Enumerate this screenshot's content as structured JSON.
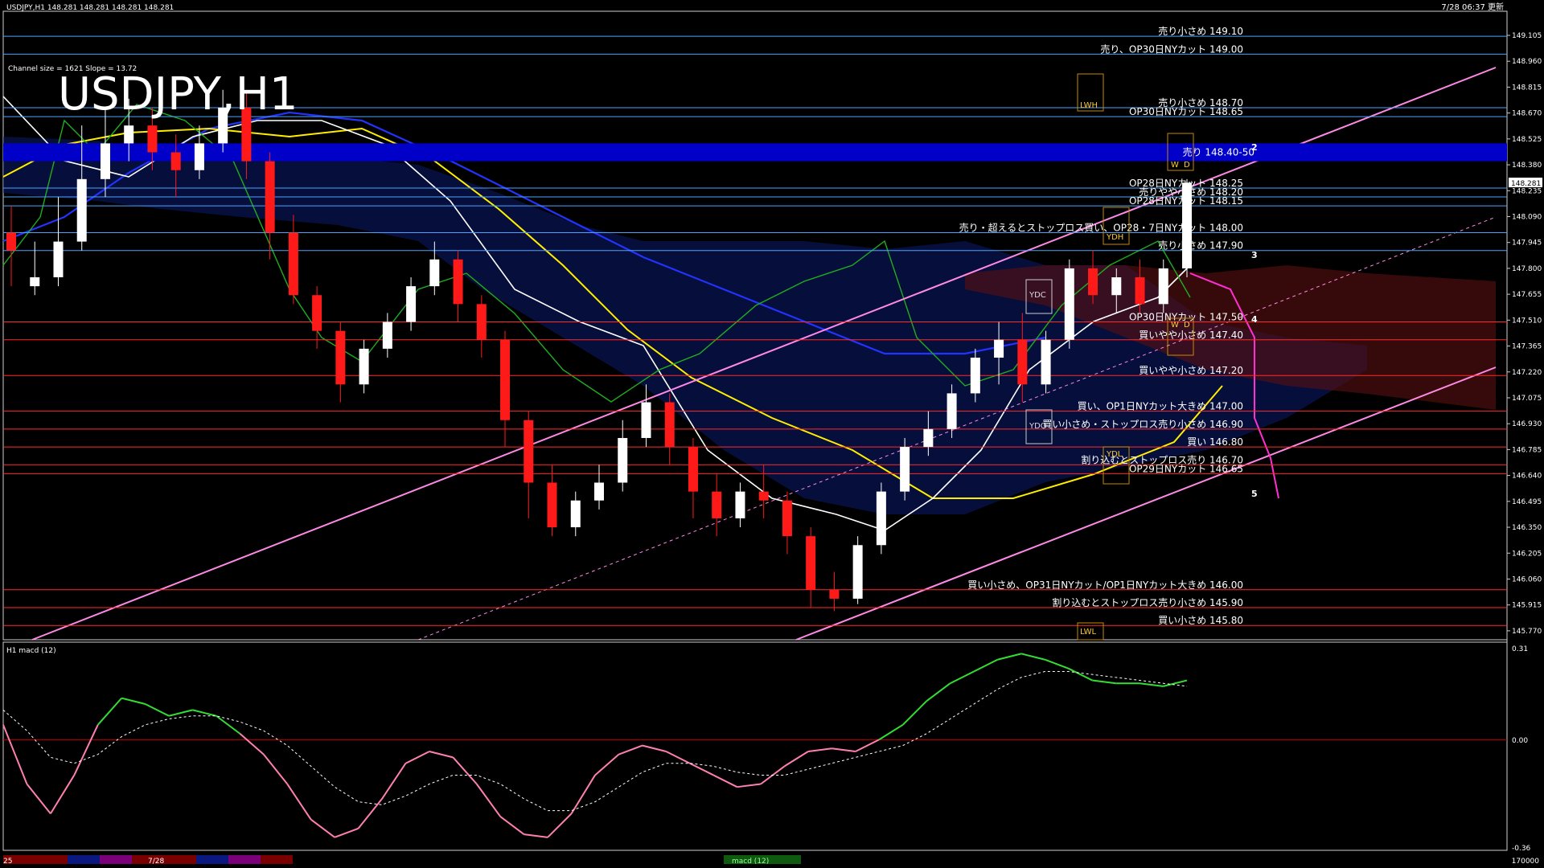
{
  "header": {
    "symbol_info": "USDJPY,H1  148.281 148.281 148.281 148.281",
    "timestamp": "7/28 06:37 更新"
  },
  "overlay": {
    "big_title": "USDJPY,H1",
    "channel_info": "Channel size = 1621 Slope = 13.72"
  },
  "chart_data": [
    {
      "type": "candlestick",
      "title": "USDJPY,H1",
      "ylim": [
        145.72,
        149.24
      ],
      "current_price": 148.281,
      "price_ticks": [
        149.105,
        148.96,
        148.815,
        148.67,
        148.525,
        148.38,
        148.235,
        148.09,
        147.945,
        147.8,
        147.655,
        147.51,
        147.365,
        147.22,
        147.075,
        146.93,
        146.785,
        146.64,
        146.495,
        146.35,
        146.205,
        146.06,
        145.915,
        145.77
      ],
      "resistance_zone": {
        "label": "売り 148.40-50",
        "low": 148.4,
        "high": 148.5
      },
      "levels": [
        {
          "price": 149.1,
          "label": "売り小さめ 149.10",
          "color": "#4aa3ff"
        },
        {
          "price": 149.0,
          "label": "売り、OP30日NYカット 149.00",
          "color": "#4aa3ff"
        },
        {
          "price": 148.7,
          "label": "売り小さめ 148.70",
          "color": "#4aa3ff"
        },
        {
          "price": 148.65,
          "label": "OP30日NYカット 148.65",
          "color": "#4aa3ff"
        },
        {
          "price": 148.25,
          "label": "OP28日NYカット 148.25",
          "color": "#4aa3ff"
        },
        {
          "price": 148.2,
          "label": "売りやや小さめ 148.20",
          "color": "#4aa3ff"
        },
        {
          "price": 148.15,
          "label": "OP28日NYカット 148.15",
          "color": "#4aa3ff"
        },
        {
          "price": 148.0,
          "label": "売り・超えるとストップロス買い、OP28・7日NYカット 148.00",
          "color": "#4aa3ff"
        },
        {
          "price": 147.9,
          "label": "売り小さめ 147.90",
          "color": "#4aa3ff"
        },
        {
          "price": 147.5,
          "label": "OP30日NYカット 147.50",
          "color": "#ff2a2a"
        },
        {
          "price": 147.4,
          "label": "買いやや小さめ 147.40",
          "color": "#ff2a2a"
        },
        {
          "price": 147.2,
          "label": "買いやや小さめ 147.20",
          "color": "#ff2a2a"
        },
        {
          "price": 147.0,
          "label": "買い、OP1日NYカット大きめ 147.00",
          "color": "#ff2a2a"
        },
        {
          "price": 146.9,
          "label": "買い小さめ・ストップロス売り小さめ 146.90",
          "color": "#ff2a2a"
        },
        {
          "price": 146.8,
          "label": "買い 146.80",
          "color": "#ff2a2a"
        },
        {
          "price": 146.7,
          "label": "割り込むとストップロス売り 146.70",
          "color": "#ff2a2a"
        },
        {
          "price": 146.65,
          "label": "OP29日NYカット 146.65",
          "color": "#ff2a2a"
        },
        {
          "price": 146.0,
          "label": "買い小さめ、OP31日NYカット/OP1日NYカット大きめ 146.00",
          "color": "#ff2a2a"
        },
        {
          "price": 145.9,
          "label": "割り込むとストップロス売り小さめ 145.90",
          "color": "#ff2a2a"
        },
        {
          "price": 145.8,
          "label": "買い小さめ 145.80",
          "color": "#ff2a2a"
        }
      ],
      "box_labels": [
        "LWH",
        "W",
        "D",
        "YDH",
        "YDC",
        "YDO",
        "YDL",
        "W",
        "D",
        "LWL"
      ],
      "channel_numbers": [
        "2",
        "3",
        "4",
        "5"
      ],
      "candles": [
        [
          148.0,
          148.15,
          147.9,
          147.7
        ],
        [
          147.7,
          147.95,
          147.75,
          147.65
        ],
        [
          147.75,
          148.2,
          147.95,
          147.7
        ],
        [
          147.95,
          148.6,
          148.3,
          147.9
        ],
        [
          148.3,
          148.7,
          148.5,
          148.2
        ],
        [
          148.5,
          148.75,
          148.6,
          148.4
        ],
        [
          148.6,
          148.7,
          148.45,
          148.35
        ],
        [
          148.45,
          148.55,
          148.35,
          148.2
        ],
        [
          148.35,
          148.6,
          148.5,
          148.3
        ],
        [
          148.5,
          148.8,
          148.7,
          148.45
        ],
        [
          148.7,
          148.8,
          148.4,
          148.3
        ],
        [
          148.4,
          148.45,
          148.0,
          147.85
        ],
        [
          148.0,
          148.1,
          147.65,
          147.6
        ],
        [
          147.65,
          147.7,
          147.45,
          147.35
        ],
        [
          147.45,
          147.5,
          147.15,
          147.05
        ],
        [
          147.15,
          147.4,
          147.35,
          147.1
        ],
        [
          147.35,
          147.55,
          147.5,
          147.3
        ],
        [
          147.5,
          147.75,
          147.7,
          147.45
        ],
        [
          147.7,
          147.95,
          147.85,
          147.65
        ],
        [
          147.85,
          147.9,
          147.6,
          147.5
        ],
        [
          147.6,
          147.65,
          147.4,
          147.3
        ],
        [
          147.4,
          147.45,
          146.95,
          146.8
        ],
        [
          146.95,
          147.0,
          146.6,
          146.4
        ],
        [
          146.6,
          146.7,
          146.35,
          146.3
        ],
        [
          146.35,
          146.55,
          146.5,
          146.3
        ],
        [
          146.5,
          146.7,
          146.6,
          146.45
        ],
        [
          146.6,
          146.95,
          146.85,
          146.55
        ],
        [
          146.85,
          147.15,
          147.05,
          146.8
        ],
        [
          147.05,
          147.1,
          146.8,
          146.7
        ],
        [
          146.8,
          146.85,
          146.55,
          146.4
        ],
        [
          146.55,
          146.65,
          146.4,
          146.3
        ],
        [
          146.4,
          146.6,
          146.55,
          146.35
        ],
        [
          146.55,
          146.7,
          146.5,
          146.4
        ],
        [
          146.5,
          146.55,
          146.3,
          146.2
        ],
        [
          146.3,
          146.35,
          146.0,
          145.9
        ],
        [
          146.0,
          146.1,
          145.95,
          145.88
        ],
        [
          145.95,
          146.3,
          146.25,
          145.92
        ],
        [
          146.25,
          146.6,
          146.55,
          146.2
        ],
        [
          146.55,
          146.85,
          146.8,
          146.5
        ],
        [
          146.8,
          147.0,
          146.9,
          146.75
        ],
        [
          146.9,
          147.15,
          147.1,
          146.85
        ],
        [
          147.1,
          147.35,
          147.3,
          147.05
        ],
        [
          147.3,
          147.5,
          147.4,
          147.15
        ],
        [
          147.4,
          147.55,
          147.15,
          147.05
        ],
        [
          147.15,
          147.45,
          147.4,
          147.1
        ],
        [
          147.4,
          147.85,
          147.8,
          147.35
        ],
        [
          147.8,
          147.9,
          147.65,
          147.6
        ],
        [
          147.65,
          147.8,
          147.75,
          147.55
        ],
        [
          147.75,
          147.85,
          147.6,
          147.55
        ],
        [
          147.6,
          147.85,
          147.8,
          147.55
        ],
        [
          147.8,
          148.3,
          148.28,
          147.75
        ]
      ]
    },
    {
      "type": "line",
      "title": "H1  macd (12)",
      "ylim": [
        -0.363,
        0.31
      ],
      "y_ticks": [
        0.31,
        0.0,
        -0.363
      ],
      "series": [
        {
          "values": [
            0.05,
            -0.15,
            -0.25,
            -0.12,
            0.05,
            0.14,
            0.12,
            0.08,
            0.1,
            0.08,
            0.02,
            -0.05,
            -0.15,
            -0.27,
            -0.33,
            -0.3,
            -0.2,
            -0.08,
            -0.04,
            -0.06,
            -0.15,
            -0.26,
            -0.32,
            -0.33,
            -0.25,
            -0.12,
            -0.05,
            -0.02,
            -0.04,
            -0.08,
            -0.12,
            -0.16,
            -0.15,
            -0.09,
            -0.04,
            -0.03,
            -0.04,
            0.0,
            0.05,
            0.13,
            0.19,
            0.23,
            0.27,
            0.29,
            0.27,
            0.24,
            0.2,
            0.19,
            0.19,
            0.18,
            0.2
          ]
        },
        {
          "values": [
            0.1,
            0.03,
            -0.06,
            -0.08,
            -0.05,
            0.01,
            0.05,
            0.07,
            0.08,
            0.08,
            0.06,
            0.03,
            -0.02,
            -0.09,
            -0.16,
            -0.21,
            -0.22,
            -0.19,
            -0.15,
            -0.12,
            -0.12,
            -0.15,
            -0.2,
            -0.24,
            -0.24,
            -0.21,
            -0.16,
            -0.11,
            -0.08,
            -0.08,
            -0.09,
            -0.11,
            -0.12,
            -0.12,
            -0.1,
            -0.08,
            -0.06,
            -0.04,
            -0.02,
            0.02,
            0.07,
            0.12,
            0.17,
            0.21,
            0.23,
            0.23,
            0.22,
            0.21,
            0.2,
            0.19,
            0.18
          ]
        }
      ]
    }
  ],
  "footer": {
    "date_label": "7/28",
    "left_label": "25",
    "indicator_label": "macd (12)",
    "right_label": "170000"
  }
}
